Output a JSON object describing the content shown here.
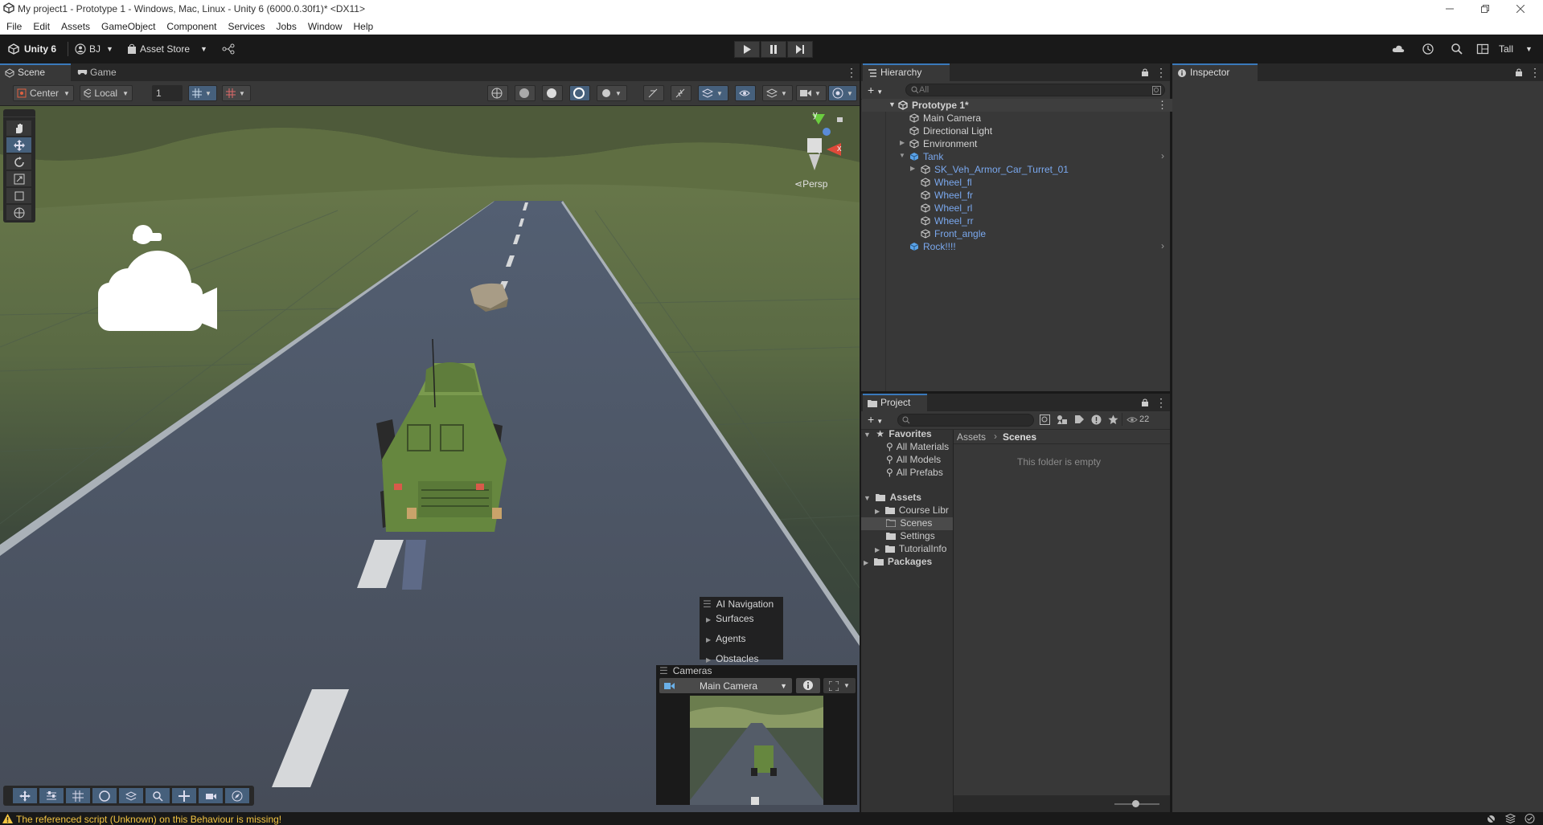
{
  "window": {
    "title": "My project1 - Prototype 1 - Windows, Mac, Linux - Unity 6 (6000.0.30f1)* <DX11>"
  },
  "menu": [
    "File",
    "Edit",
    "Assets",
    "GameObject",
    "Component",
    "Services",
    "Jobs",
    "Window",
    "Help"
  ],
  "toolbar": {
    "brand": "Unity 6",
    "account": "BJ",
    "asset_store": "Asset Store",
    "layout": "Tall"
  },
  "scene_tabs": {
    "scene": "Scene",
    "game": "Game"
  },
  "scene_toolbar": {
    "pivot": "Center",
    "space": "Local",
    "grid_value": "1",
    "persp": "Persp"
  },
  "overlays": {
    "ai_nav_title": "AI Navigation",
    "ai_nav_items": [
      "Surfaces",
      "Agents",
      "Obstacles"
    ],
    "cameras_title": "Cameras",
    "camera_selected": "Main Camera"
  },
  "hierarchy": {
    "tab": "Hierarchy",
    "search_placeholder": "All",
    "scene_name": "Prototype 1*",
    "items": [
      {
        "label": "Main Camera"
      },
      {
        "label": "Directional Light"
      },
      {
        "label": "Environment"
      },
      {
        "label": "Tank"
      },
      {
        "label": "SK_Veh_Armor_Car_Turret_01"
      },
      {
        "label": "Wheel_fl"
      },
      {
        "label": "Wheel_fr"
      },
      {
        "label": "Wheel_rl"
      },
      {
        "label": "Wheel_rr"
      },
      {
        "label": "Front_angle"
      },
      {
        "label": "Rock!!!!"
      }
    ]
  },
  "inspector": {
    "tab": "Inspector"
  },
  "project": {
    "tab": "Project",
    "count": "22",
    "favorites_label": "Favorites",
    "favorites": [
      "All Materials",
      "All Models",
      "All Prefabs"
    ],
    "assets_label": "Assets",
    "assets": [
      "Course Libr",
      "Scenes",
      "Settings",
      "TutorialInfo"
    ],
    "packages_label": "Packages",
    "breadcrumb": [
      "Assets",
      "Scenes"
    ],
    "empty_msg": "This folder is empty"
  },
  "status": {
    "message": "The referenced script (Unknown) on this Behaviour is missing!"
  },
  "colors": {
    "accent": "#3a79bb",
    "panel": "#383838",
    "dark": "#191919",
    "warning": "#f4c542"
  }
}
